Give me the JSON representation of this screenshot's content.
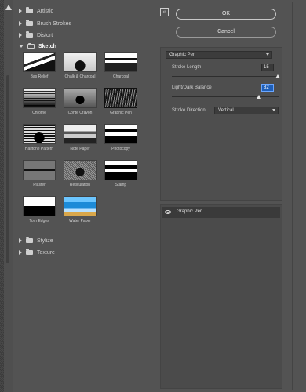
{
  "gallery": {
    "folders_top": [
      {
        "label": "Artistic"
      },
      {
        "label": "Brush Strokes"
      },
      {
        "label": "Distort"
      },
      {
        "label": "Sketch"
      }
    ],
    "folders_bottom": [
      {
        "label": "Stylize"
      },
      {
        "label": "Texture"
      }
    ],
    "thumbnails": [
      {
        "label": "Bas Relief"
      },
      {
        "label": "Chalk & Charcoal"
      },
      {
        "label": "Charcoal"
      },
      {
        "label": "Chrome"
      },
      {
        "label": "Conté Crayon"
      },
      {
        "label": "Graphic Pen"
      },
      {
        "label": "Halftone Pattern"
      },
      {
        "label": "Note Paper"
      },
      {
        "label": "Photocopy"
      },
      {
        "label": "Plaster"
      },
      {
        "label": "Reticulation"
      },
      {
        "label": "Stamp"
      },
      {
        "label": "Torn Edges"
      },
      {
        "label": "Water Paper"
      }
    ],
    "selected": "Graphic Pen"
  },
  "buttons": {
    "ok": "OK",
    "cancel": "Cancel"
  },
  "collapse_icon": "«",
  "settings": {
    "filter_select": "Graphic Pen",
    "stroke_length_label": "Stroke Length",
    "stroke_length_value": "15",
    "light_dark_label": "Light/Dark Balance",
    "light_dark_value": "82",
    "stroke_direction_label": "Stroke Direction:",
    "stroke_direction_value": "Vertical"
  },
  "layers": {
    "items": [
      {
        "label": "Graphic Pen"
      }
    ]
  }
}
